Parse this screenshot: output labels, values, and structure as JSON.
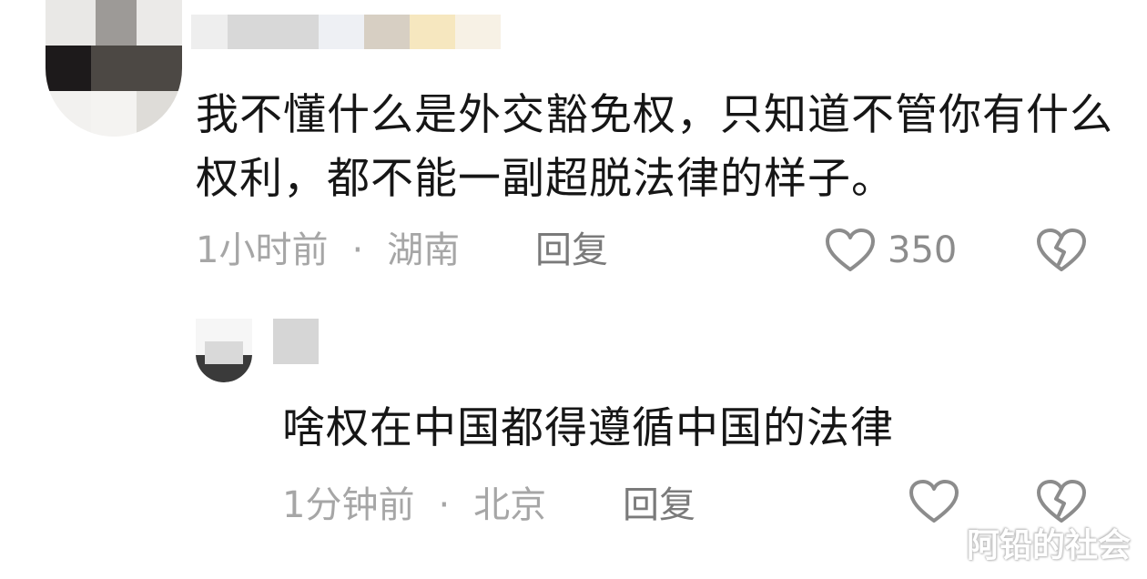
{
  "comments": [
    {
      "text": "我不懂什么是外交豁免权，只知道不管你有什么权利，都不能一副超脱法律的样子。",
      "time": "1小时前",
      "separator": "·",
      "location": "湖南",
      "reply_label": "回复",
      "like_count": "350",
      "like_icon": "heart-outline-icon",
      "dislike_icon": "broken-heart-icon"
    },
    {
      "text": "啥权在中国都得遵循中国的法律",
      "time": "1分钟前",
      "separator": "·",
      "location": "北京",
      "reply_label": "回复",
      "like_count": "",
      "like_icon": "heart-outline-icon",
      "dislike_icon": "broken-heart-icon"
    }
  ],
  "watermark": "阿铅的社会",
  "colors": {
    "text": "#161616",
    "meta": "#a6a6a6",
    "reply": "#7a7a7a",
    "icon": "#8c8c8c",
    "background": "#ffffff"
  }
}
